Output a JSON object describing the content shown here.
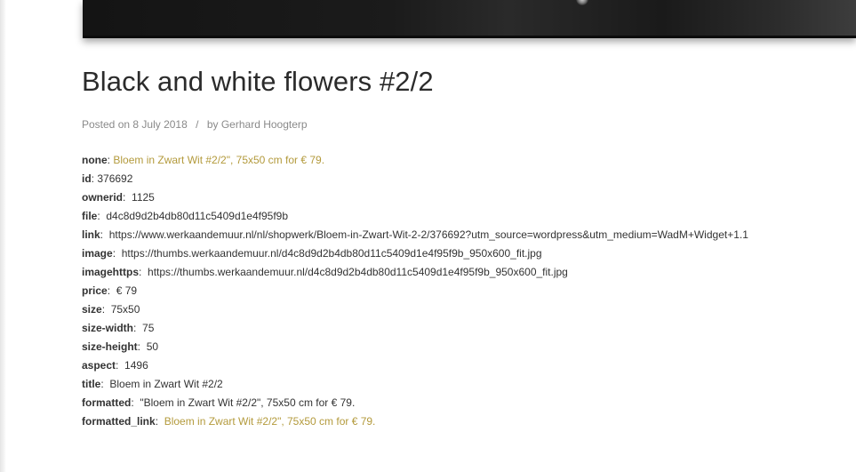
{
  "post": {
    "title": "Black and white flowers #2/2",
    "meta": {
      "posted_on_label": "Posted on",
      "date": "8 July 2018",
      "separator": "/",
      "by_label": "by",
      "author": "Gerhard Hoogterp"
    }
  },
  "fields": [
    {
      "key": "none",
      "sep": ": ",
      "value": "Bloem in Zwart Wit #2/2\", 75x50 cm for € 79.",
      "link": true
    },
    {
      "key": "id",
      "sep": ": ",
      "value": "376692",
      "link": false
    },
    {
      "key": "ownerid",
      "sep": ":  ",
      "value": "1125",
      "link": false
    },
    {
      "key": "file",
      "sep": ":  ",
      "value": "d4c8d9d2b4db80d11c5409d1e4f95f9b",
      "link": false
    },
    {
      "key": "link",
      "sep": ":  ",
      "value": "https://www.werkaandemuur.nl/nl/shopwerk/Bloem-in-Zwart-Wit-2-2/376692?utm_source=wordpress&utm_medium=WadM+Widget+1.1",
      "link": false
    },
    {
      "key": "image",
      "sep": ":  ",
      "value": "https://thumbs.werkaandemuur.nl/d4c8d9d2b4db80d11c5409d1e4f95f9b_950x600_fit.jpg",
      "link": false
    },
    {
      "key": "imagehttps",
      "sep": ":  ",
      "value": "https://thumbs.werkaandemuur.nl/d4c8d9d2b4db80d11c5409d1e4f95f9b_950x600_fit.jpg",
      "link": false
    },
    {
      "key": "price",
      "sep": ":  ",
      "value": "€ 79",
      "link": false
    },
    {
      "key": "size",
      "sep": ":  ",
      "value": "75x50",
      "link": false
    },
    {
      "key": "size-width",
      "sep": ":  ",
      "value": "75",
      "link": false
    },
    {
      "key": "size-height",
      "sep": ":  ",
      "value": "50",
      "link": false
    },
    {
      "key": "aspect",
      "sep": ":  ",
      "value": "1496",
      "link": false
    },
    {
      "key": "title",
      "sep": ":  ",
      "value": "Bloem in Zwart Wit #2/2",
      "link": false
    },
    {
      "key": "formatted",
      "sep": ":  ",
      "value": "\"Bloem in Zwart Wit #2/2\", 75x50 cm for € 79.",
      "link": false
    },
    {
      "key": "formatted_link",
      "sep": ":  ",
      "value": "Bloem in Zwart Wit #2/2\", 75x50 cm for € 79.",
      "link": true
    }
  ],
  "colors": {
    "link": "#b39a3c",
    "text": "#333333",
    "meta": "#8a8a8a",
    "title": "#2b2b2b"
  }
}
